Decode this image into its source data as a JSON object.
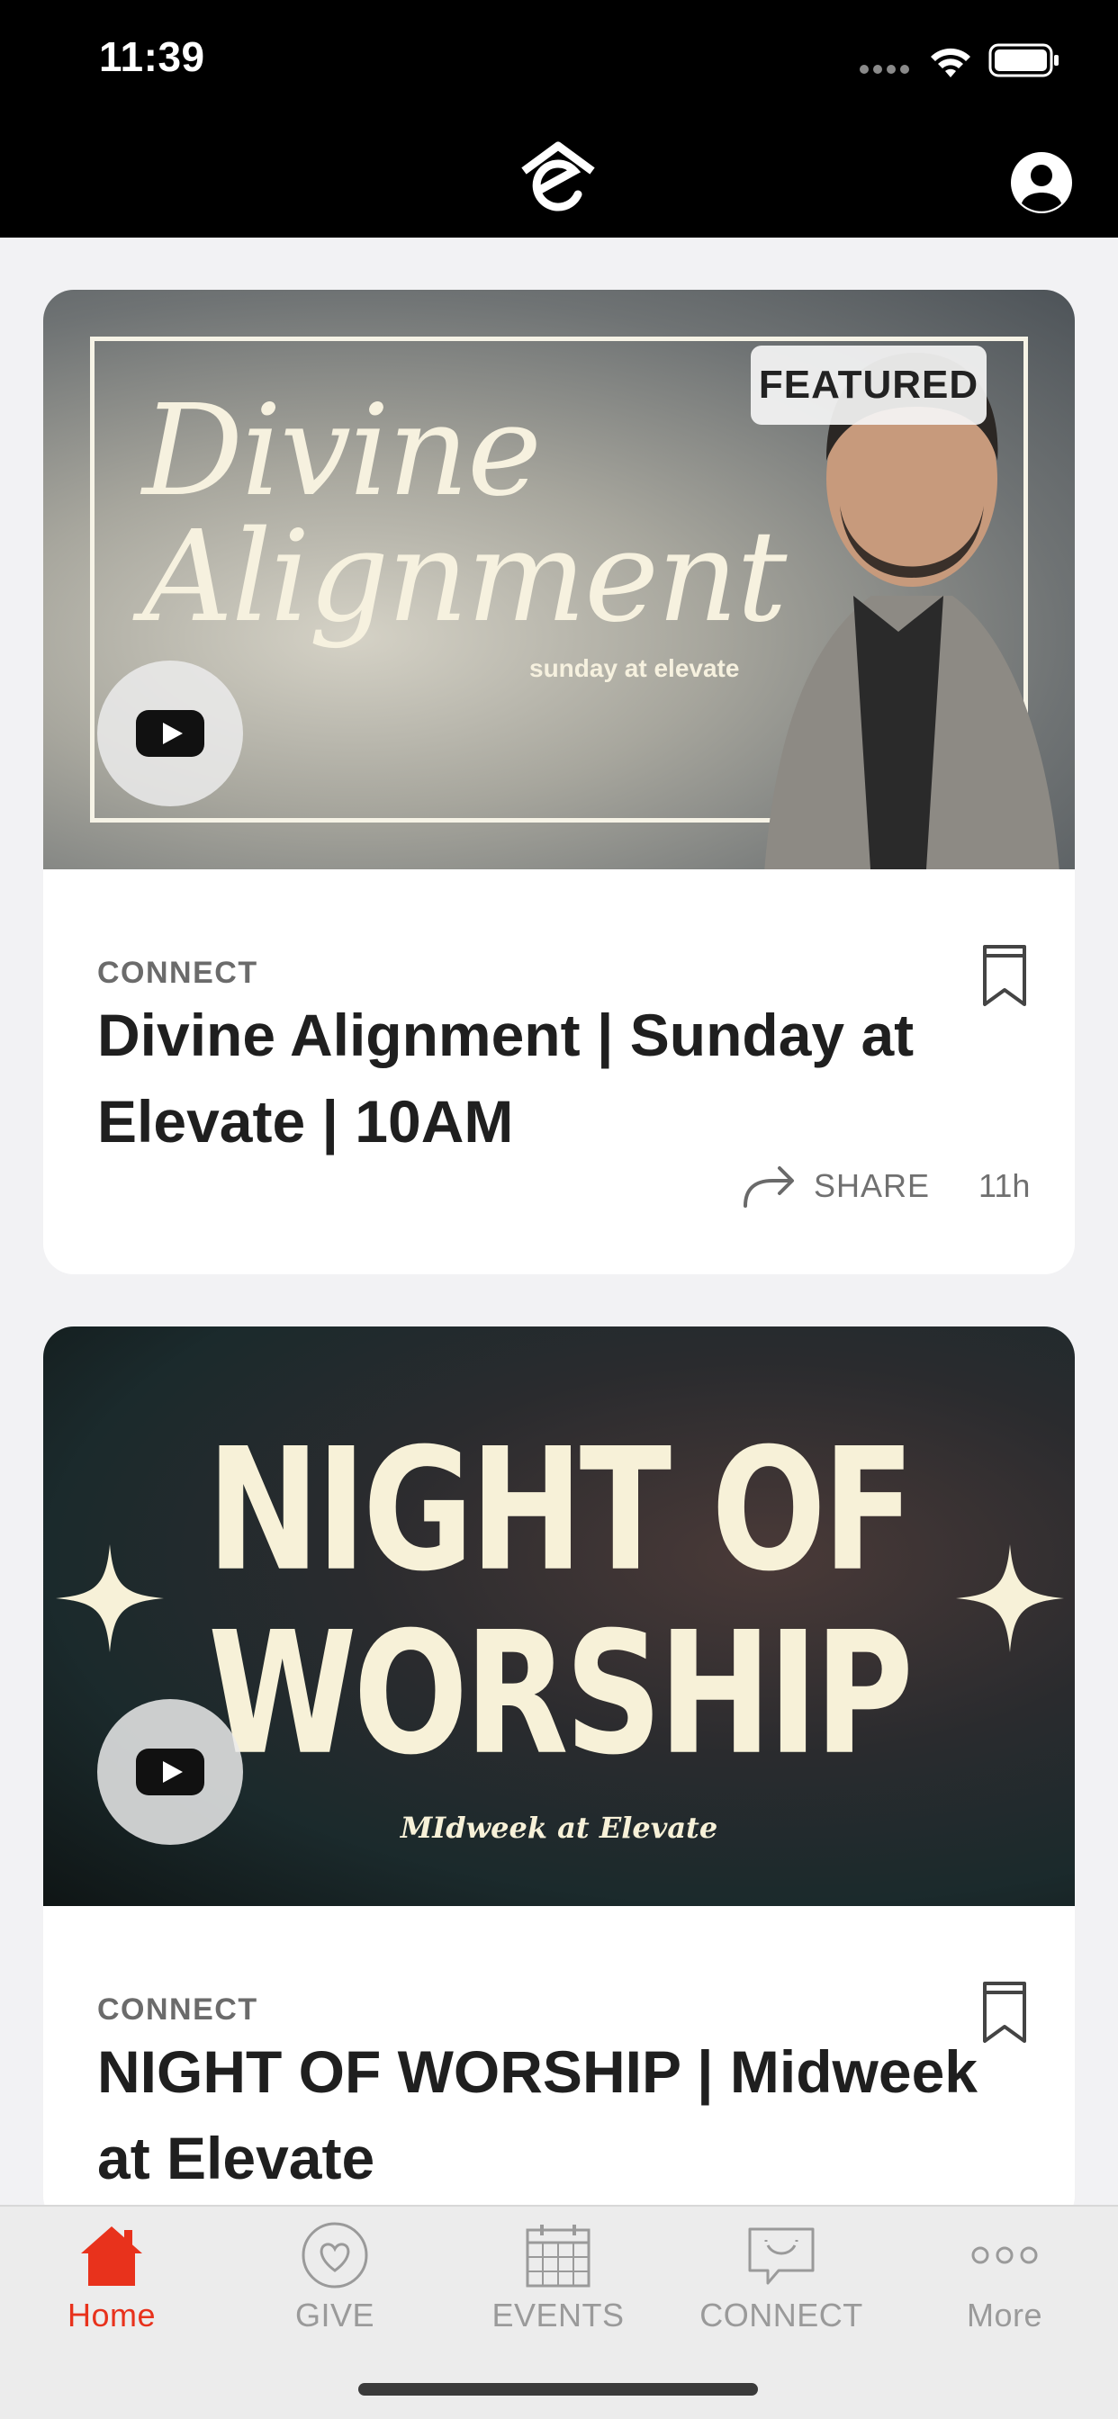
{
  "status_bar": {
    "time": "11:39"
  },
  "header": {
    "logo_icon": "elevate-logo-icon",
    "profile_icon": "profile-icon"
  },
  "feed": [
    {
      "thumbnail": {
        "title_line1": "Divine",
        "title_line2": "Alignment",
        "subtitle": "sunday at elevate"
      },
      "badge": "FEATURED",
      "category": "CONNECT",
      "title": "Divine Alignment | Sunday at Elevate | 10AM",
      "share_label": "SHARE",
      "age": "11h"
    },
    {
      "thumbnail": {
        "title_line1": "NIGHT OF",
        "title_line2": "WORSHIP",
        "subtitle": "MIdweek at Elevate"
      },
      "category": "CONNECT",
      "title": "NIGHT OF WORSHIP | Midweek at Elevate"
    }
  ],
  "tabs": [
    {
      "label": "Home",
      "icon": "home-icon",
      "active": true
    },
    {
      "label": "GIVE",
      "icon": "heart-icon",
      "active": false
    },
    {
      "label": "EVENTS",
      "icon": "calendar-icon",
      "active": false
    },
    {
      "label": "CONNECT",
      "icon": "chat-smile-icon",
      "active": false
    },
    {
      "label": "More",
      "icon": "more-icon",
      "active": false
    }
  ],
  "colors": {
    "accent": "#e8321c",
    "header_bg": "#000000",
    "page_bg": "#f2f2f4"
  }
}
